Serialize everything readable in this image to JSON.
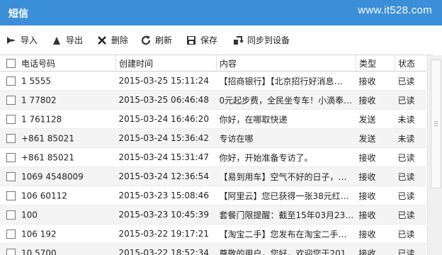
{
  "title": "短信",
  "watermark": "www.it528.com",
  "toolbar": {
    "import": "导入",
    "export": "导出",
    "delete": "删除",
    "refresh": "刷新",
    "save": "保存",
    "sync": "同步到设备"
  },
  "columns": {
    "phone": "电话号码",
    "time": "创建时间",
    "content": "内容",
    "type": "类型",
    "status": "状态"
  },
  "rows": [
    {
      "phone": "1        5555",
      "time": "2015-03-25 15:11:24",
      "content": "【招商银行】【北京招行好消息…",
      "type": "接收",
      "status": "已读"
    },
    {
      "phone": "1        77802",
      "time": "2015-03-25 06:46:48",
      "content": "0元起步费，全民坐专车！小滴奉…",
      "type": "接收",
      "status": "已读"
    },
    {
      "phone": "1        761128",
      "time": "2015-03-24 16:46:20",
      "content": "你好，在哪取快递",
      "type": "发送",
      "status": "未读"
    },
    {
      "phone": "+861       85021",
      "time": "2015-03-24 15:36:42",
      "content": "专访在哪",
      "type": "发送",
      "status": "未读"
    },
    {
      "phone": "+861       85021",
      "time": "2015-03-24 15:31:47",
      "content": "你好，开始准备专访了。",
      "type": "接收",
      "status": "已读"
    },
    {
      "phone": "1069     4548009",
      "time": "2015-03-24 12:36:54",
      "content": "【易到用车】空气不好的日子，…",
      "type": "接收",
      "status": "已读"
    },
    {
      "phone": "106       60112",
      "time": "2015-03-23 15:08:46",
      "content": "【阿里云】您已获得一张38元红…",
      "type": "接收",
      "status": "已读"
    },
    {
      "phone": "100",
      "time": "2015-03-23 10:45:39",
      "content": "套餐门限提醒：截至15年03月23…",
      "type": "接收",
      "status": "已读"
    },
    {
      "phone": "106        192",
      "time": "2015-03-22 19:17:21",
      "content": "【淘宝二手】您发布在淘宝二手…",
      "type": "接收",
      "status": "已读"
    },
    {
      "phone": "10        5700",
      "time": "2015-03-22 18:52:34",
      "content": "尊敬的用户，您好，欢迎您于201…",
      "type": "接收",
      "status": "已读"
    }
  ],
  "colors": {
    "titlebar": "#3a8fd8",
    "alt_row": "#f4f4f4"
  },
  "icons": {
    "import": "import-arrow-icon",
    "export": "export-arrow-icon",
    "delete": "close-x-icon",
    "refresh": "refresh-icon",
    "save": "floppy-disk-icon",
    "sync": "sync-arrow-icon"
  }
}
